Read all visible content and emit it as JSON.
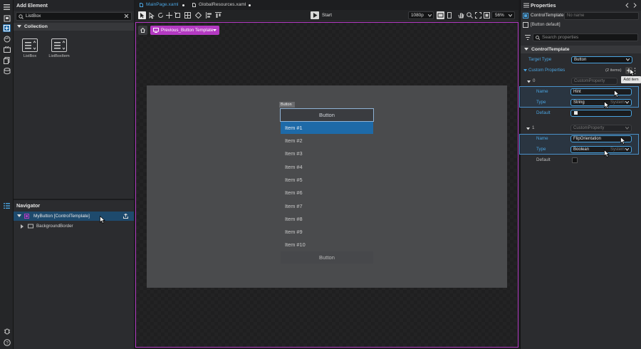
{
  "left_panel": {
    "title": "Add Element",
    "search_value": "ListBox",
    "collection_label": "Collection",
    "elements": [
      {
        "label": "ListBox",
        "icon": "listbox-icon"
      },
      {
        "label": "ListBoxItem",
        "icon": "listboxitem-icon"
      }
    ]
  },
  "navigator": {
    "title": "Navigator",
    "root_label": "MyButton [ControlTemplate]",
    "child_label": "BackgroundBorder"
  },
  "tabs": [
    {
      "label": "MainPage.xaml"
    },
    {
      "label": "GlobalResources.xaml"
    }
  ],
  "toolbar": {
    "start_label": "Start",
    "resolution": "1080p",
    "zoom": "56%"
  },
  "breadcrumb": {
    "template_label": "Previous_Button Template"
  },
  "preview": {
    "button_tag": "Button",
    "top_button": "Button",
    "bottom_button": "Button",
    "items": [
      "Item #1",
      "Item #2",
      "Item #3",
      "Item #4",
      "Item #5",
      "Item #6",
      "Item #7",
      "Item #8",
      "Item #9",
      "Item #10"
    ],
    "selected_index": 0
  },
  "properties": {
    "title": "Properties",
    "type_label": "ControlTemplate",
    "name_placeholder": "No name",
    "default_label": "[Button default]",
    "search_placeholder": "Search properties",
    "section": "ControlTemplate",
    "target_type_label": "Target Type",
    "target_type_value": "Button",
    "custom_label": "Custom Properties",
    "custom_count": "(2 items)",
    "add_tooltip": "Add item",
    "entries": [
      {
        "index": "0",
        "kind": "CustomProperty",
        "name_label": "Name",
        "name_value": "Hint",
        "type_label": "Type",
        "type_value": "String",
        "type_ns": "System",
        "default_label": "Default"
      },
      {
        "index": "1",
        "kind": "CustomProperty",
        "name_label": "Name",
        "name_value": "FlipOrientation",
        "type_label": "Type",
        "type_value": "Boolean",
        "type_ns": "System",
        "default_label": "Default"
      }
    ]
  },
  "colors": {
    "accent": "#4aa3df",
    "selection": "#1e6aa8",
    "template_highlight": "#b43ac2"
  }
}
